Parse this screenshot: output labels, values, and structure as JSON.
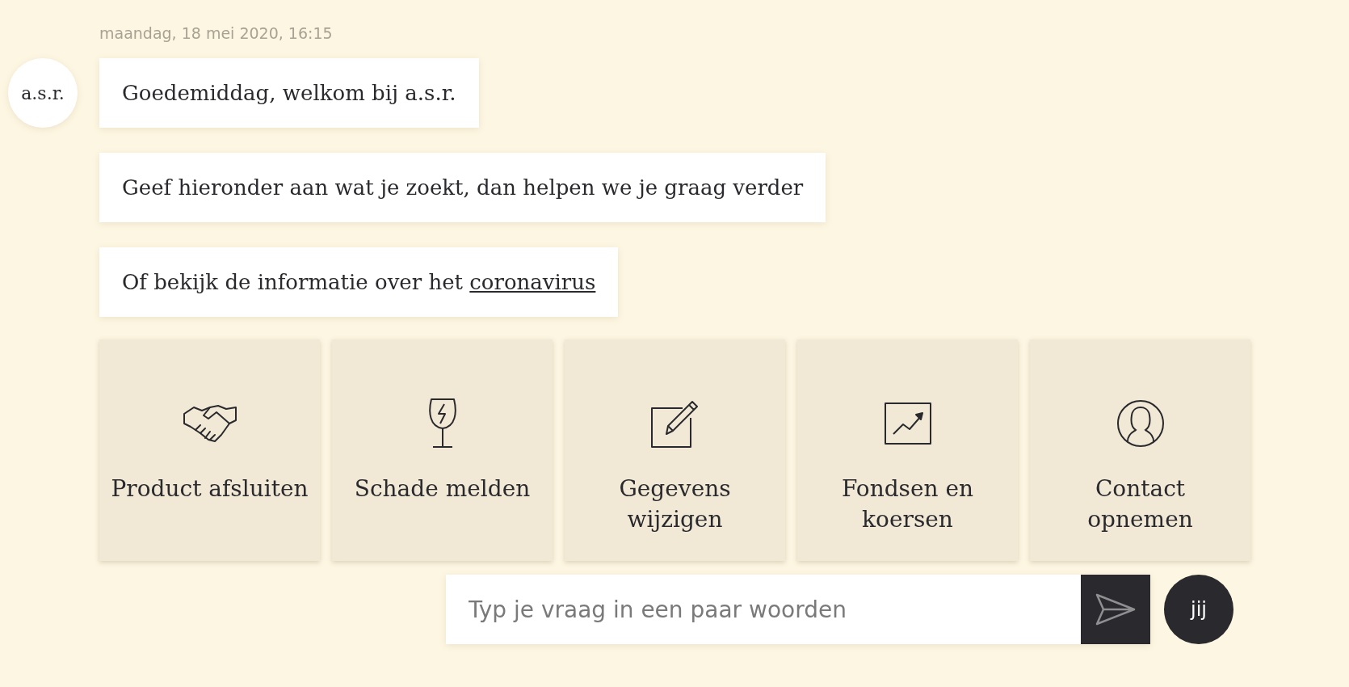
{
  "timestamp": "maandag, 18 mei 2020, 16:15",
  "bot_avatar": "a.s.r.",
  "messages": [
    {
      "text": "Goedemiddag, welkom bij a.s.r."
    },
    {
      "text": "Geef hieronder aan wat je zoekt, dan helpen we je graag verder"
    },
    {
      "text": "Of bekijk de informatie over het",
      "link": "coronavirus"
    }
  ],
  "tiles": [
    {
      "label": "Product afsluiten"
    },
    {
      "label": "Schade melden"
    },
    {
      "label": "Gegevens wijzigen"
    },
    {
      "label": "Fondsen en koersen"
    },
    {
      "label": "Contact opnemen"
    }
  ],
  "composer": {
    "placeholder": "Typ je vraag in een paar woorden"
  },
  "user_avatar": "jij"
}
